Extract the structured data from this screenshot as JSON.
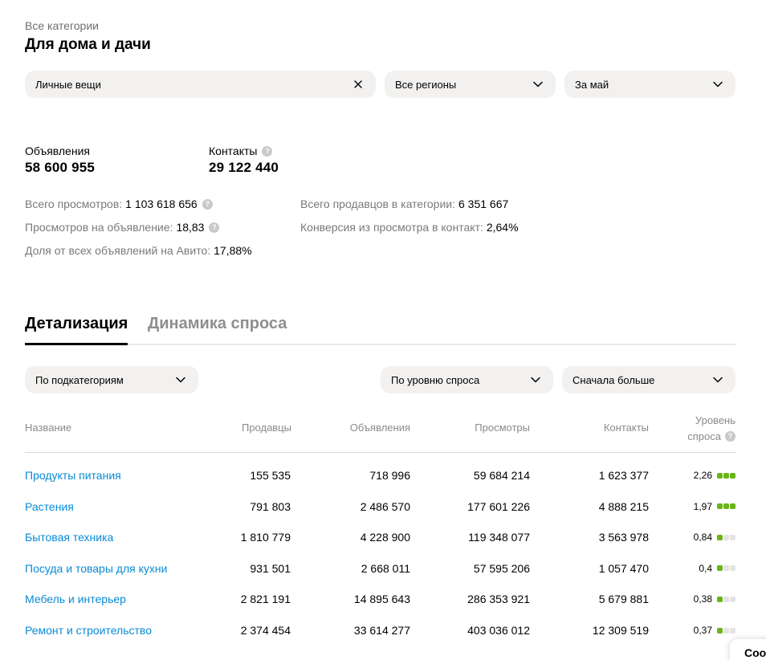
{
  "breadcrumb": "Все категории",
  "title": "Для дома и дачи",
  "filters": {
    "subcategory": "Личные вещи",
    "region": "Все регионы",
    "period": "За май"
  },
  "metrics": {
    "ads_label": "Объявления",
    "ads_value": "58 600 955",
    "contacts_label": "Контакты",
    "contacts_value": "29 122 440"
  },
  "stats": {
    "views_label": "Всего просмотров:",
    "views_value": "1 103 618 656",
    "views_per_ad_label": "Просмотров на объявление:",
    "views_per_ad_value": "18,83",
    "share_label": "Доля от всех объявлений на Авито:",
    "share_value": "17,88%",
    "sellers_label": "Всего продавцов в категории:",
    "sellers_value": "6 351 667",
    "conversion_label": "Конверсия из просмотра в контакт:",
    "conversion_value": "2,64%"
  },
  "tabs": [
    "Детализация",
    "Динамика спроса"
  ],
  "table_controls": {
    "group_by": "По подкатегориям",
    "sort_field": "По уровню спроса",
    "sort_order": "Сначала больше"
  },
  "table": {
    "headers": {
      "name": "Название",
      "sellers": "Продавцы",
      "ads": "Объявления",
      "views": "Просмотры",
      "contacts": "Контакты",
      "level_1": "Уровень",
      "level_2": "спроса"
    },
    "rows": [
      {
        "name": "Продукты питания",
        "sellers": "155 535",
        "ads": "718 996",
        "views": "59 684 214",
        "contacts": "1 623 377",
        "level": "2,26",
        "level_dots": 3
      },
      {
        "name": "Растения",
        "sellers": "791 803",
        "ads": "2 486 570",
        "views": "177 601 226",
        "contacts": "4 888 215",
        "level": "1,97",
        "level_dots": 3
      },
      {
        "name": "Бытовая техника",
        "sellers": "1 810 779",
        "ads": "4 228 900",
        "views": "119 348 077",
        "contacts": "3 563 978",
        "level": "0,84",
        "level_dots": 1
      },
      {
        "name": "Посуда и товары для кухни",
        "sellers": "931 501",
        "ads": "2 668 011",
        "views": "57 595 206",
        "contacts": "1 057 470",
        "level": "0,4",
        "level_dots": 1
      },
      {
        "name": "Мебель и интерьер",
        "sellers": "2 821 191",
        "ads": "14 895 643",
        "views": "286 353 921",
        "contacts": "5 679 881",
        "level": "0,38",
        "level_dots": 1
      },
      {
        "name": "Ремонт и строительство",
        "sellers": "2 374 454",
        "ads": "33 614 277",
        "views": "403 036 012",
        "contacts": "12 309 519",
        "level": "0,37",
        "level_dots": 1
      }
    ]
  },
  "chat_stub": "Coo",
  "colors": {
    "link": "#0a8ad6",
    "level_on": "#6ab416",
    "level_off": "#e3e3e3",
    "filter_bg": "#f2f1f0"
  }
}
